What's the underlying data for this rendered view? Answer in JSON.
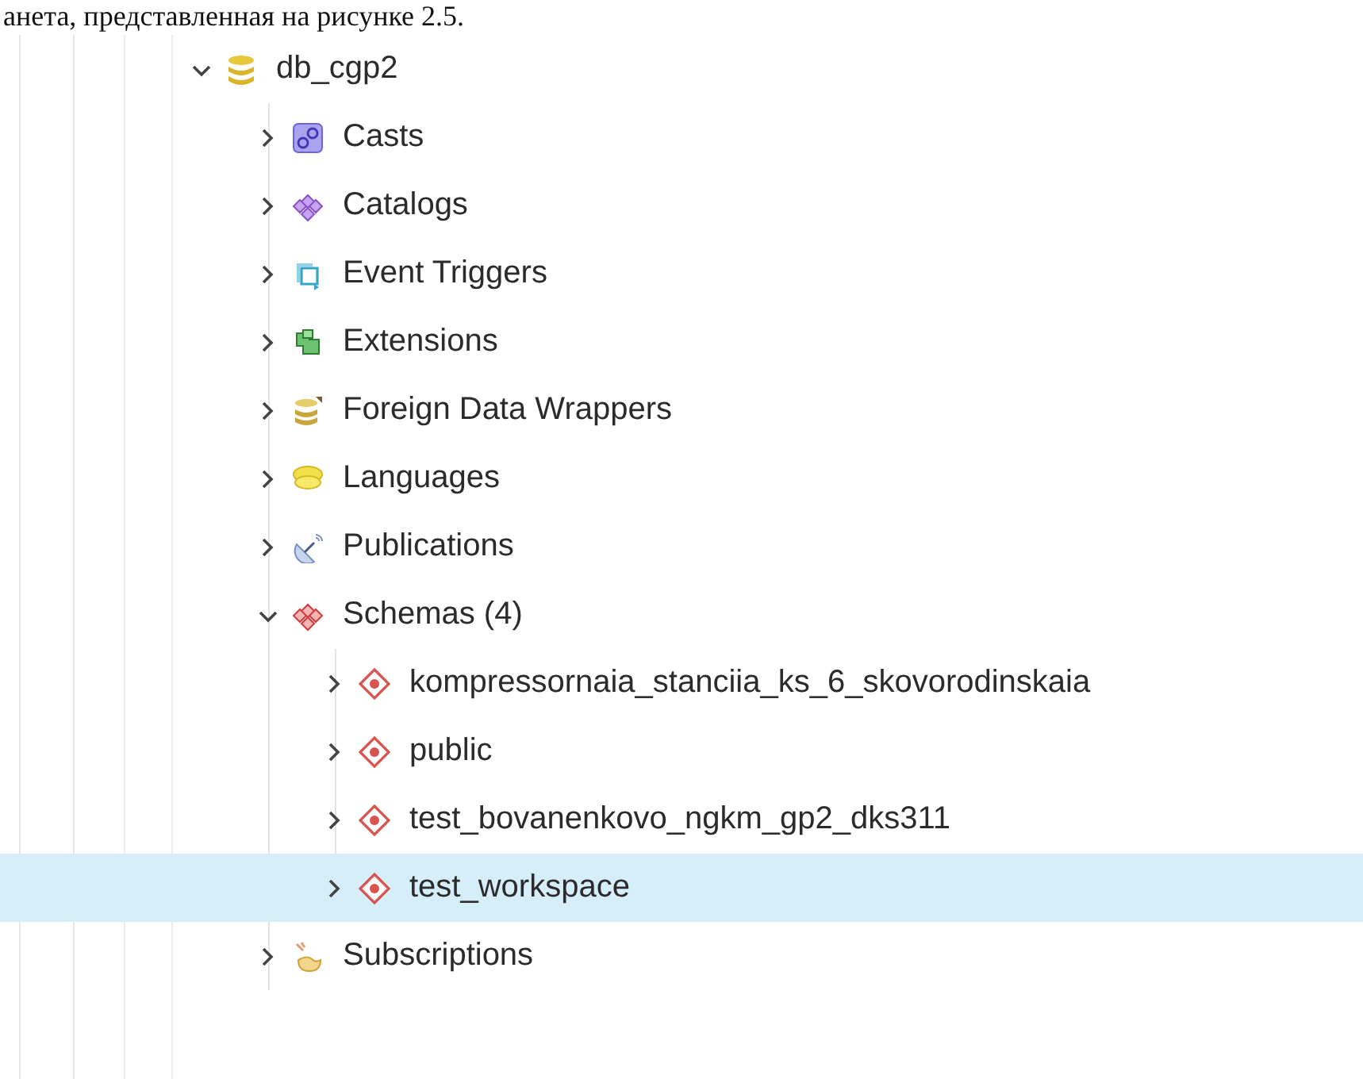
{
  "caption": "анета, представленная на рисунке 2.5.",
  "tree": [
    {
      "label": "db_cgp2",
      "kind": "database",
      "expanded": true,
      "selected": false,
      "children": [
        {
          "label": "Casts",
          "kind": "cast",
          "expanded": false,
          "selected": false
        },
        {
          "label": "Catalogs",
          "kind": "catalog",
          "expanded": false,
          "selected": false
        },
        {
          "label": "Event Triggers",
          "kind": "trigger",
          "expanded": false,
          "selected": false
        },
        {
          "label": "Extensions",
          "kind": "extension",
          "expanded": false,
          "selected": false
        },
        {
          "label": "Foreign Data Wrappers",
          "kind": "fdw",
          "expanded": false,
          "selected": false
        },
        {
          "label": "Languages",
          "kind": "language",
          "expanded": false,
          "selected": false
        },
        {
          "label": "Publications",
          "kind": "publication",
          "expanded": false,
          "selected": false
        },
        {
          "label": "Schemas (4)",
          "kind": "schemas",
          "expanded": true,
          "selected": false,
          "children": [
            {
              "label": "kompressornaia_stanciia_ks_6_skovorodinskaia",
              "kind": "schema",
              "expanded": false,
              "selected": false
            },
            {
              "label": "public",
              "kind": "schema",
              "expanded": false,
              "selected": false
            },
            {
              "label": "test_bovanenkovo_ngkm_gp2_dks311",
              "kind": "schema",
              "expanded": false,
              "selected": false
            },
            {
              "label": "test_workspace",
              "kind": "schema",
              "expanded": false,
              "selected": true
            }
          ]
        },
        {
          "label": "Subscriptions",
          "kind": "subscription",
          "expanded": false,
          "selected": false
        }
      ]
    }
  ]
}
